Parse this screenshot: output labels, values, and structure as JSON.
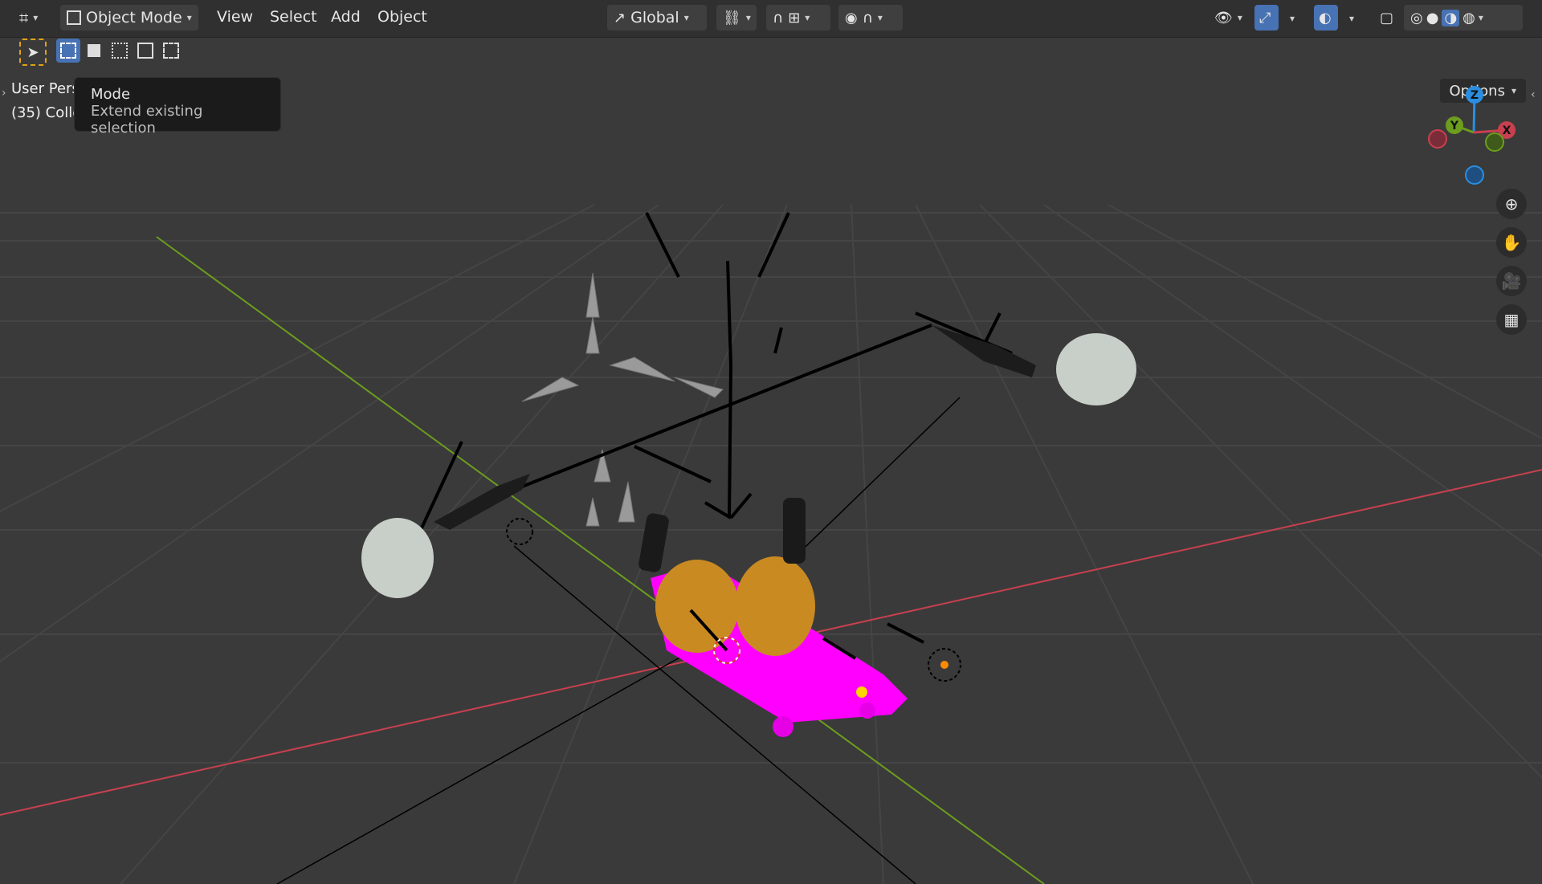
{
  "header": {
    "editor_type_icon": "editor-type-icon",
    "mode_label": "Object Mode",
    "menu": [
      "View",
      "Select",
      "Add",
      "Object"
    ],
    "transform_orientation": "Global",
    "options_label": "Options"
  },
  "viewport": {
    "view_name": "User Pers",
    "collection_label": "(35) Colle"
  },
  "tooltip": {
    "title": "Mode",
    "description": "Extend existing selection"
  },
  "gizmo": {
    "z": "Z",
    "y": "Y",
    "x": "X"
  },
  "colors": {
    "header_bg": "#303030",
    "viewport_bg": "#3a3a3a",
    "accent_blue": "#4772b3",
    "selected_magenta": "#ff00ff",
    "x_axis": "#c8404f",
    "y_axis": "#6c9d1e",
    "z_axis": "#2b8ee0"
  }
}
